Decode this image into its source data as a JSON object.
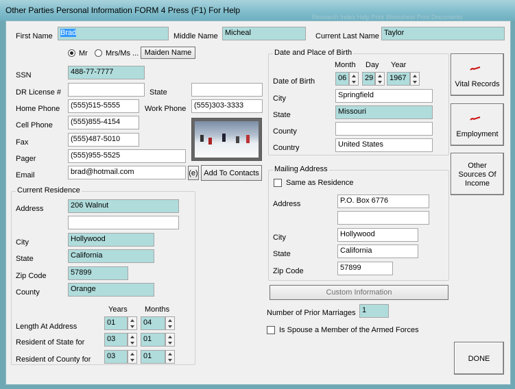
{
  "window": {
    "title": "Other Parties Personal Information   FORM 4   Press (F1) For Help",
    "background_ghost_text": "Research   Index   Help   Print Worksheet   Print Documents"
  },
  "personal": {
    "first_name_label": "First Name",
    "first_name": "Brad",
    "middle_name_label": "Middle Name",
    "middle_name": "Micheal",
    "last_name_label": "Current Last Name",
    "last_name": "Taylor",
    "title_mr": "Mr",
    "title_mrs": "Mrs/Ms ...",
    "maiden_name_button": "Maiden Name",
    "ssn_label": "SSN",
    "ssn": "488-77-7777",
    "dl_label": "DR License #",
    "dl": "",
    "state_label": "State",
    "state": "",
    "home_phone_label": "Home Phone",
    "home_phone": "(555)515-5555",
    "work_phone_label": "Work Phone",
    "work_phone": "(555)303-3333",
    "cell_phone_label": "Cell Phone",
    "cell_phone": "(555)855-4154",
    "fax_label": "Fax",
    "fax": "(555)487-5010",
    "pager_label": "Pager",
    "pager": "(555)955-5525",
    "email_label": "Email",
    "email": "brad@hotmail.com",
    "email_button": "(e)",
    "add_contacts_button": "Add To Contacts"
  },
  "residence": {
    "caption": "Current Residence",
    "address_label": "Address",
    "address1": "206 Walnut",
    "address2": "",
    "city_label": "City",
    "city": "Hollywood",
    "state_label": "State",
    "state": "California",
    "zip_label": "Zip Code",
    "zip": "57899",
    "county_label": "County",
    "county": "Orange",
    "years_header": "Years",
    "months_header": "Months",
    "length_label": "Length At Address",
    "length_years": "01",
    "length_months": "04",
    "state_res_label": "Resident of State for",
    "state_years": "03",
    "state_months": "01",
    "county_res_label": "Resident of County for",
    "county_years": "03",
    "county_months": "01"
  },
  "birth": {
    "caption": "Date and Place of Birth",
    "month_header": "Month",
    "day_header": "Day",
    "year_header": "Year",
    "dob_label": "Date of Birth",
    "month": "06",
    "day": "29",
    "year": "1967",
    "city_label": "City",
    "city": "Springfield",
    "state_label": "State",
    "state": "Missouri",
    "county_label": "County",
    "county": "",
    "country_label": "Country",
    "country": "United States"
  },
  "mailing": {
    "caption": "Mailing Address",
    "same_label": "Same as Residence",
    "address_label": "Address",
    "address1": "P.O. Box 6776",
    "address2": "",
    "city_label": "City",
    "city": "Hollywood",
    "state_label": "State",
    "state": "California",
    "zip_label": "Zip Code",
    "zip": "57899"
  },
  "custom_info_button": "Custom Information",
  "prior_marriages_label": "Number of Prior Marriages",
  "prior_marriages": "1",
  "armed_forces_label": "Is Spouse a Member of the Armed Forces",
  "side_buttons": {
    "vital_records": "Vital Records",
    "employment": "Employment",
    "other_income_1": "Other",
    "other_income_2": "Sources Of",
    "other_income_3": "Income"
  },
  "done_button": "DONE",
  "colors": {
    "window_frame": "#6ea8b4",
    "field_teal": "#b0dcdc",
    "client_bg": "#f0f0f0",
    "mark_red": "#cc1111"
  }
}
